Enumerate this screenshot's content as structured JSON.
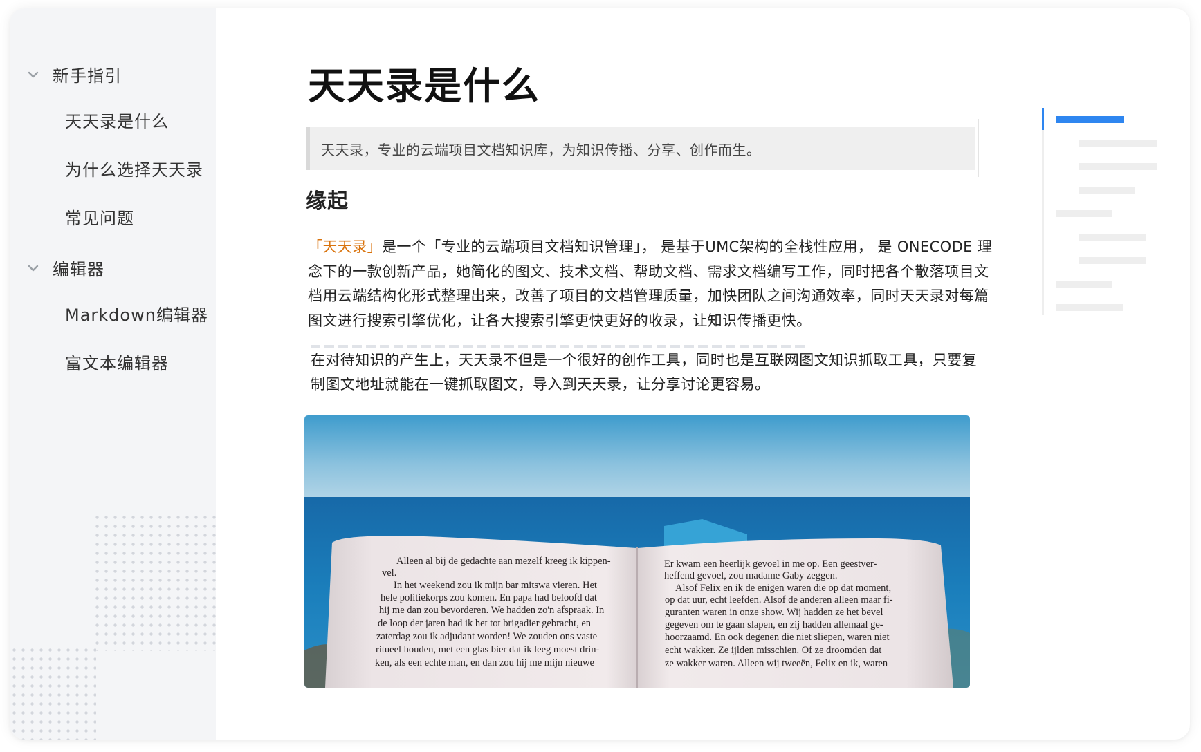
{
  "sidebar": {
    "groups": [
      {
        "label": "新手指引",
        "items": [
          "天天录是什么",
          "为什么选择天天录",
          "常见问题"
        ]
      },
      {
        "label": "编辑器",
        "items": [
          "Markdown编辑器",
          "富文本编辑器"
        ]
      }
    ]
  },
  "article": {
    "title": "天天录是什么",
    "quote": "天天录，专业的云端项目文档知识库，为知识传播、分享、创作而生。",
    "section_heading": "缘起",
    "para1_highlight": "「天天录」",
    "para1_rest": "是一个「专业的云端项目文档知识管理」， 是基于UMC架构的全栈性应用， 是 ONECODE 理念下的一款创新产品，她简化的图文、技术文档、帮助文档、需求文档编写工作，同时把各个散落项目文档用云端结构化形式整理出来，改善了项目的文档管理质量，加快团队之间沟通效率，同时天天录对每篇图文进行搜索引擎优化，让各大搜索引擎更快更好的收录，让知识传播更快。",
    "para2": "在对待知识的产生上，天天录不但是一个很好的创作工具，同时也是互联网图文知识抓取工具，只要复制图文地址就能在一键抓取图文，导入到天天录，让分享讨论更容易。",
    "image": {
      "page_left_lines": [
        "Alleen al bij de gedachte aan mezelf kreeg ik kippen-",
        "vel.",
        "In het weekend zou ik mijn bar mitswa vieren. Het",
        "hele politiekorps zou komen. En papa had beloofd dat",
        "hij me dan zou bevorderen. We hadden zo'n afspraak. In",
        "de loop der jaren had ik het tot brigadier gebracht, en",
        "zaterdag zou ik adjudant worden! We zouden ons vaste",
        "ritueel houden, met een glas bier dat ik leeg moest drin-",
        "ken, als een echte man, en dan zou hij me mijn nieuwe"
      ],
      "page_right_lines": [
        "Er kwam een heerlijk gevoel in me op. Een geestver-",
        "heffend gevoel, zou madame Gaby zeggen.",
        "Alsof Felix en ik de enigen waren die op dat moment,",
        "op dat uur, echt leefden. Alsof de anderen alleen maar fi-",
        "guranten waren in onze show. Wij hadden ze het bevel",
        "gegeven om te gaan slapen, en zij hadden allemaal ge-",
        "hoorzaamd. En ook degenen die niet sliepen, waren niet",
        "echt wakker. Ze ijlden misschien. Of ze droomden dat",
        "ze wakker waren. Alleen wij tweeën, Felix en ik, waren"
      ]
    }
  },
  "toc": {
    "active_index": 0,
    "accent_color": "#2e86f0",
    "entries": 9
  }
}
